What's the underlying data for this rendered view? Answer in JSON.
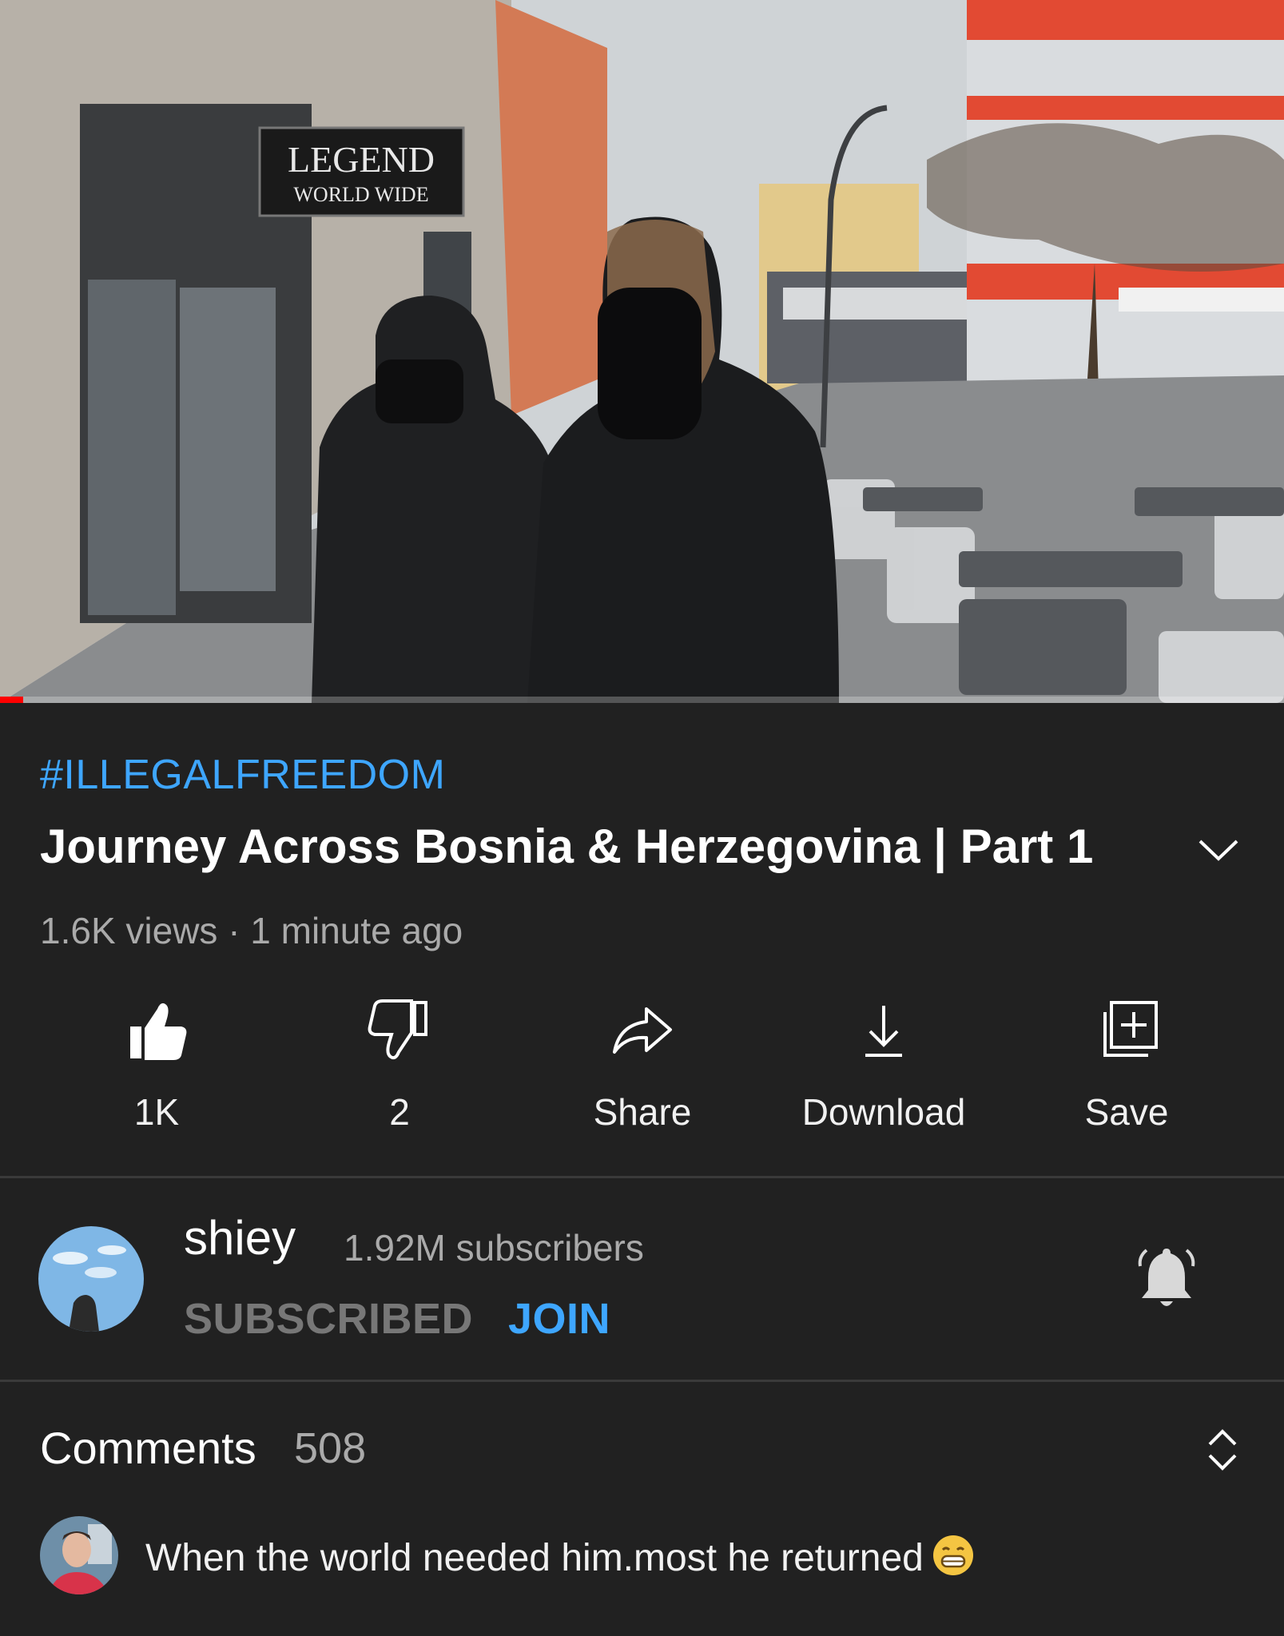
{
  "video": {
    "sign_line1": "LEGEND",
    "sign_line2": "WORLD WIDE",
    "progress_fraction": 0.018
  },
  "info": {
    "hashtag": "#ILLEGALFREEDOM",
    "title": "Journey Across Bosnia & Herzegovina | Part 1",
    "meta": "1.6K views · 1 minute ago"
  },
  "actions": {
    "like": {
      "label": "1K",
      "icon": "thumbs-up-icon"
    },
    "dislike": {
      "label": "2",
      "icon": "thumbs-down-icon"
    },
    "share": {
      "label": "Share",
      "icon": "share-icon"
    },
    "download": {
      "label": "Download",
      "icon": "download-icon"
    },
    "save": {
      "label": "Save",
      "icon": "add-to-playlist-icon"
    }
  },
  "channel": {
    "name": "shiey",
    "subscribers": "1.92M subscribers",
    "subscribed_label": "SUBSCRIBED",
    "join_label": "JOIN"
  },
  "comments": {
    "title": "Comments",
    "count": "508",
    "top_comment": "When the world needed him.most he returned"
  },
  "colors": {
    "background": "#212121",
    "link_blue": "#3ea6ff",
    "progress_red": "#ff0000",
    "secondary_text": "#aaaaaa"
  }
}
